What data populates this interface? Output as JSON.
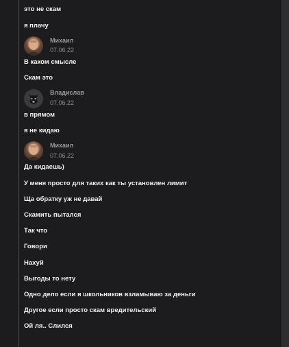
{
  "messages": {
    "m1": "это не скам",
    "m2": "я плачу",
    "m3": "В каком смысле",
    "m4": "Скам это",
    "m5": "в прямом",
    "m6": "я не кидаю",
    "m7": "Да кидаешь)",
    "m8": "У меня просто для таких как ты установлен лимит",
    "m9": "Ща обратку уж не давай",
    "m10": "Скамить пытался",
    "m11": "Так что",
    "m12": "Говори",
    "m13": "Нахуй",
    "m14": "Выгоды то нету",
    "m15": "Одно дело если я школьников взламываю за деньги",
    "m16": "Другое если просто скам вредительский",
    "m17": "Ой ля.. Слился"
  },
  "groups": {
    "g1": {
      "author": "Михаил",
      "time": "07.06.22"
    },
    "g2": {
      "author": "Владислав",
      "time": "07.06.22"
    },
    "g3": {
      "author": "Михаил",
      "time": "07.06.22"
    }
  },
  "icons": {
    "avatar_mikhail": "user-avatar-photo",
    "avatar_vladislav": "dog-avatar-icon"
  },
  "colors": {
    "background": "#1c1c1e",
    "message_text": "#f2f2f2",
    "author_text": "#9a9a9e",
    "rail": "#4a4a4e"
  }
}
